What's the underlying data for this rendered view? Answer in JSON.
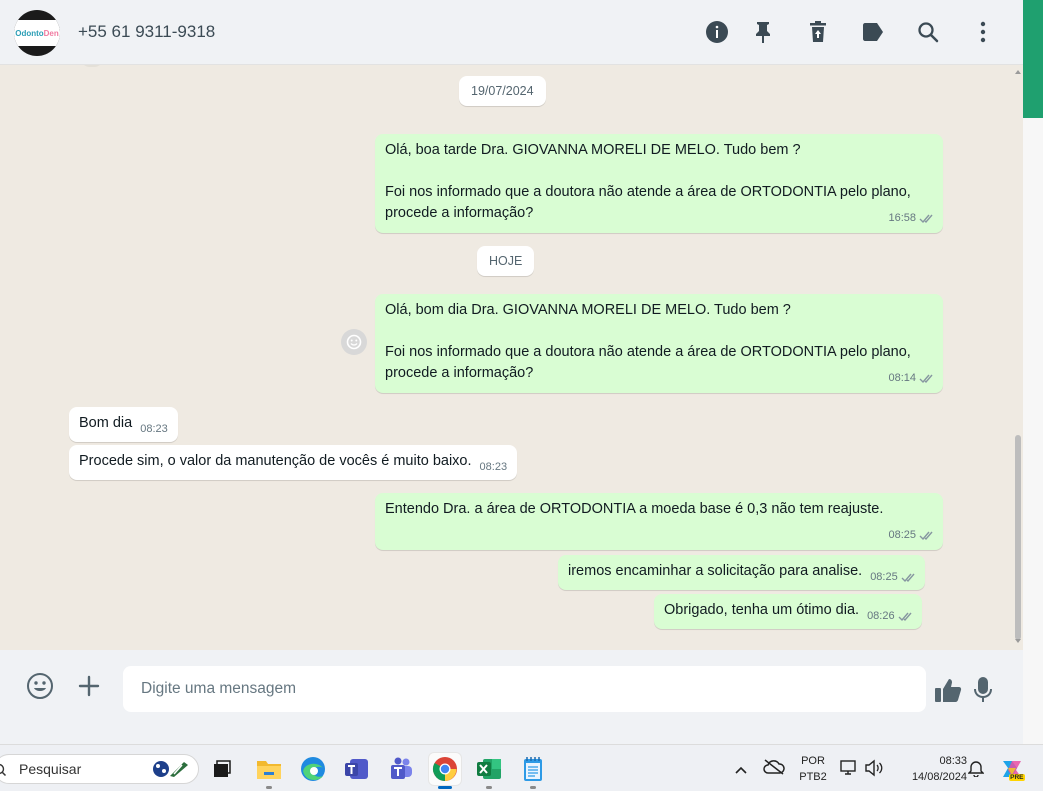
{
  "header": {
    "avatar_text_a": "Odonto",
    "avatar_text_b": "Den",
    "contact_phone": "+55 61 9311-9318",
    "icons": [
      "info-icon",
      "pin-icon",
      "delete-icon",
      "label-icon",
      "search-icon",
      "menu-icon"
    ]
  },
  "chat": {
    "date_1": "19/07/2024",
    "date_2": "HOJE",
    "messages": [
      {
        "dir": "out",
        "text": "Olá, boa tarde Dra. GIOVANNA MORELI DE MELO. Tudo bem ?\n\nFoi nos informado que a doutora não atende a área de ORTODONTIA pelo plano, procede a informação?",
        "time": "16:58"
      },
      {
        "dir": "out",
        "text": "Olá, bom dia Dra. GIOVANNA MORELI DE MELO. Tudo bem ?\n\nFoi nos informado que a doutora não atende a área de ORTODONTIA pelo plano, procede a informação?",
        "time": "08:14"
      },
      {
        "dir": "in",
        "text": "Bom dia",
        "time": "08:23"
      },
      {
        "dir": "in",
        "text": "Procede sim, o valor da manutenção de vocês é muito baixo.",
        "time": "08:23"
      },
      {
        "dir": "out",
        "text": "Entendo Dra. a área de ORTODONTIA a moeda base é 0,3 não tem reajuste.",
        "time": "08:25"
      },
      {
        "dir": "out",
        "text": "iremos encaminhar a solicitação para analise.",
        "time": "08:25"
      },
      {
        "dir": "out",
        "text": "Obrigado, tenha um ótimo dia.",
        "time": "08:26"
      }
    ]
  },
  "compose": {
    "placeholder": "Digite uma mensagem"
  },
  "taskbar": {
    "search_label": "Pesquisar",
    "lang_1": "POR",
    "lang_2": "PTB2",
    "time": "08:33",
    "date": "14/08/2024",
    "copilot_badge": "PRE"
  },
  "colors": {
    "outgoing_bubble": "#d9fdd3",
    "incoming_bubble": "#ffffff",
    "chat_background": "#efeae2",
    "accent": "#1fa06f",
    "read_ticks": "#8696a0"
  }
}
